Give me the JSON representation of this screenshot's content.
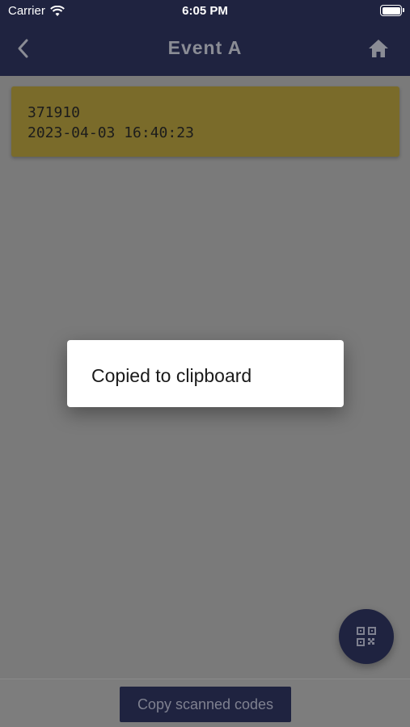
{
  "status_bar": {
    "carrier": "Carrier",
    "time": "6:05 PM"
  },
  "nav": {
    "title": "Event A",
    "back_icon": "chevron-left-icon",
    "home_icon": "home-icon"
  },
  "scans": [
    {
      "code": "371910",
      "timestamp": "2023-04-03 16:40:23"
    }
  ],
  "toast": {
    "message": "Copied to clipboard"
  },
  "fab": {
    "icon": "qr-code-icon"
  },
  "bottom": {
    "copy_label": "Copy scanned codes"
  },
  "colors": {
    "navbar": "#1f2340",
    "card": "#7a6b2a",
    "overlay": "#7a7a7a"
  }
}
